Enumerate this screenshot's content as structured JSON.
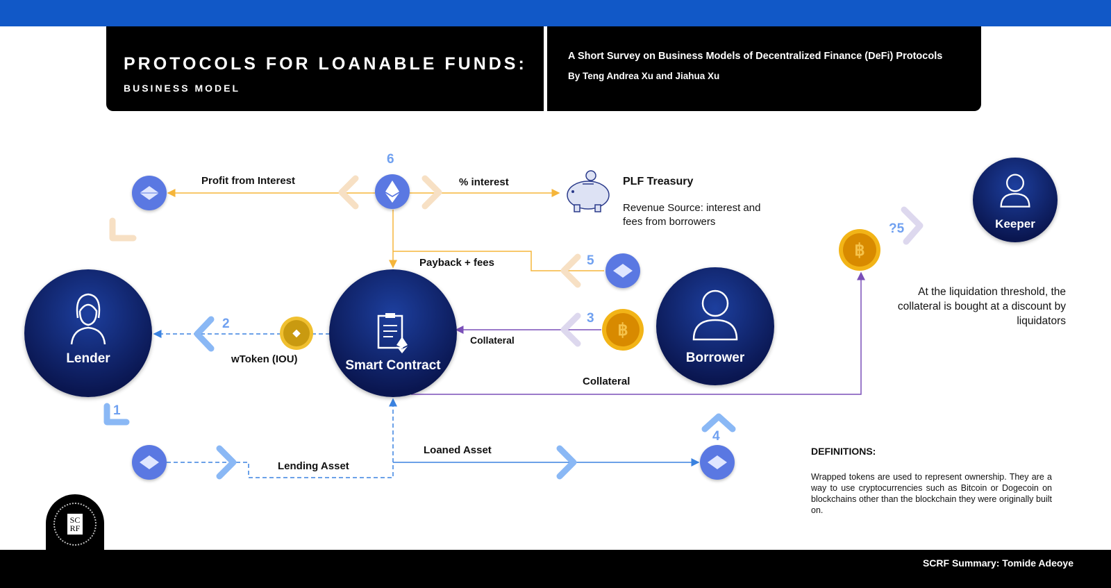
{
  "header": {
    "title": "PROTOCOLS FOR LOANABLE FUNDS:",
    "subtitle": "BUSINESS MODEL",
    "paper_title": "A Short Survey on Business Models of Decentralized Finance (DeFi) Protocols",
    "authors": "By Teng Andrea Xu and Jiahua Xu"
  },
  "nodes": {
    "lender": "Lender",
    "smart_contract": "Smart Contract",
    "borrower": "Borrower",
    "keeper": "Keeper"
  },
  "treasury": {
    "title": "PLF Treasury",
    "desc": "Revenue Source: interest and fees from borrowers"
  },
  "labels": {
    "profit": "Profit from Interest",
    "interest": "% interest",
    "payback": "Payback + fees",
    "collateral_in": "Collateral",
    "collateral_out": "Collateral",
    "wtoken": "wToken (IOU)",
    "lending": "Lending Asset",
    "loaned": "Loaned Asset"
  },
  "steps": {
    "s1": "1",
    "s2": "2",
    "s3": "3",
    "s4": "4",
    "s5": "5",
    "s5b": "?5",
    "s6": "6"
  },
  "liquidation_note": "At the liquidation threshold, the collateral is bought at a discount by liquidators",
  "definitions": {
    "title": "DEFINITIONS:",
    "text": "Wrapped tokens are used to represent ownership. They are a way to use cryptocurrencies such as Bitcoin or Dogecoin on blockchains other than the blockchain they were originally built on."
  },
  "logo": "SCRF",
  "footer": "SCRF Summary: Tomide Adeoye",
  "colors": {
    "blue_bar": "#1158c7",
    "orange": "#f5b53a",
    "purple": "#7a4fb8",
    "blue": "#3a82e0",
    "step": "#6fa0f0"
  }
}
